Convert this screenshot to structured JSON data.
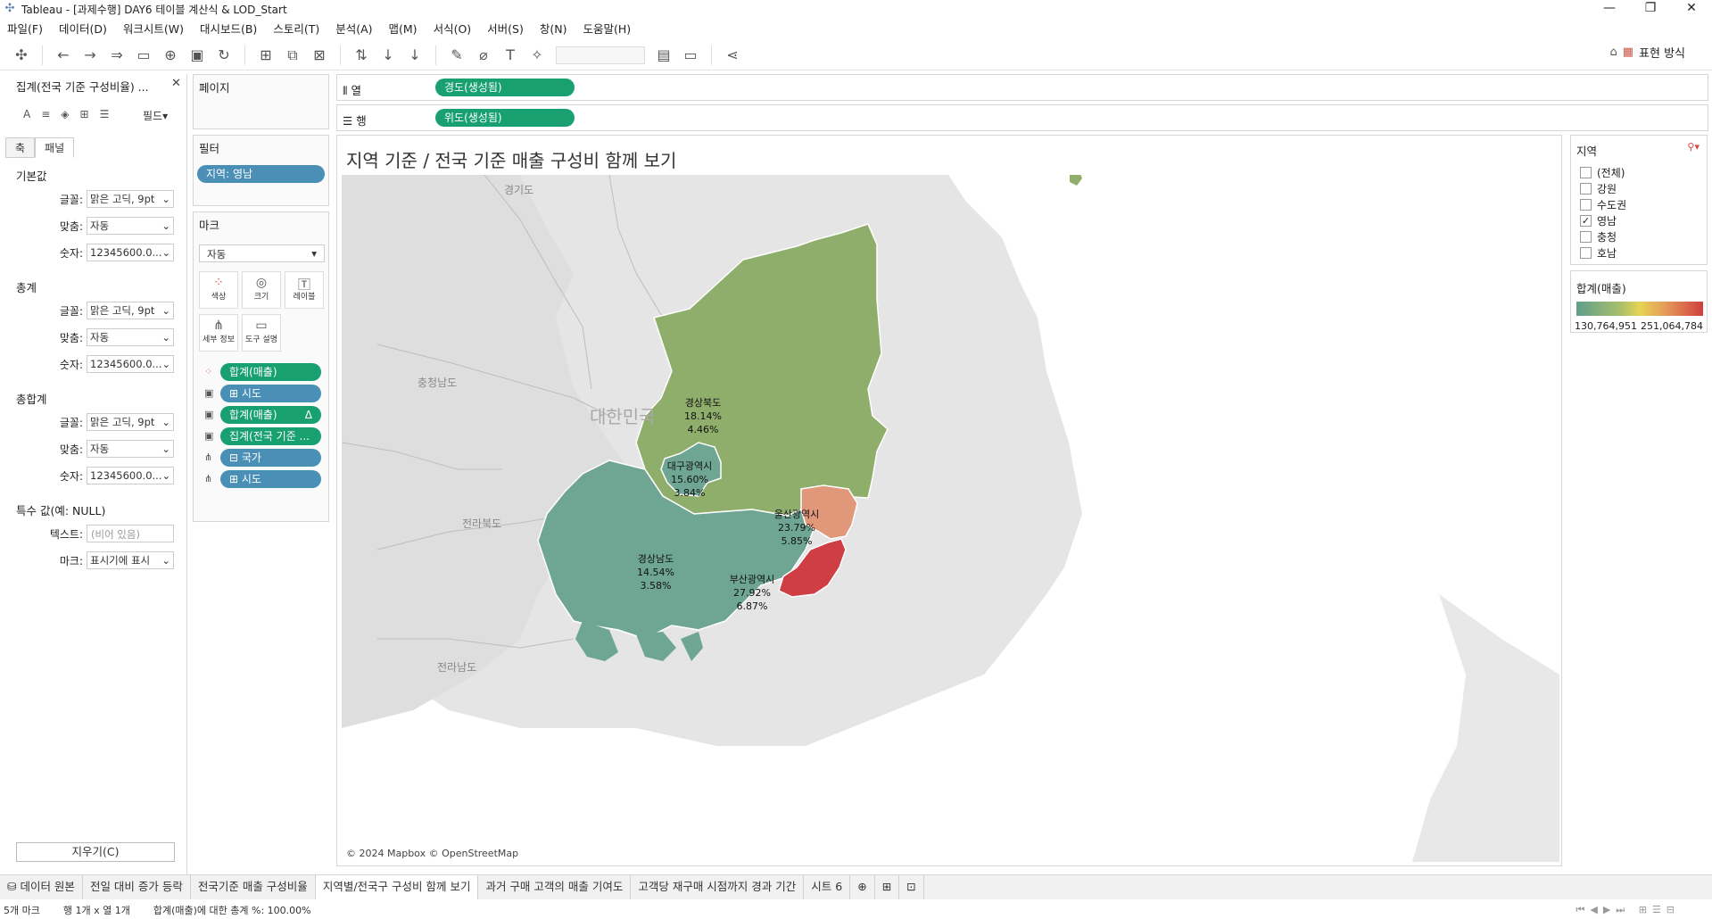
{
  "window": {
    "title": "Tableau - [과제수행] DAY6 테이블 계산식 & LOD_Start",
    "controls": [
      "—",
      "❐",
      "✕"
    ]
  },
  "menu": [
    "파일(F)",
    "데이터(D)",
    "워크시트(W)",
    "대시보드(B)",
    "스토리(T)",
    "분석(A)",
    "맵(M)",
    "서식(O)",
    "서버(S)",
    "창(N)",
    "도움말(H)"
  ],
  "toolbar": {
    "show_me": "표현 방식"
  },
  "format_pane": {
    "title": "집계(전국 기준 구성비율) ...",
    "field_menu": "필드",
    "tabs": [
      "축",
      "패널"
    ],
    "sections": [
      {
        "name": "기본값",
        "rows": [
          {
            "label": "글꼴:",
            "value": "맑은 고딕, 9pt"
          },
          {
            "label": "맞춤:",
            "value": "자동"
          },
          {
            "label": "숫자:",
            "value": "12345600.0..."
          }
        ]
      },
      {
        "name": "총계",
        "rows": [
          {
            "label": "글꼴:",
            "value": "맑은 고딕, 9pt"
          },
          {
            "label": "맞춤:",
            "value": "자동"
          },
          {
            "label": "숫자:",
            "value": "12345600.0..."
          }
        ]
      },
      {
        "name": "총합계",
        "rows": [
          {
            "label": "글꼴:",
            "value": "맑은 고딕, 9pt"
          },
          {
            "label": "맞춤:",
            "value": "자동"
          },
          {
            "label": "숫자:",
            "value": "12345600.0..."
          }
        ]
      }
    ],
    "special": {
      "name": "특수 값(예: NULL)",
      "text_label": "텍스트:",
      "text_placeholder": "(비어 있음)",
      "marks_label": "마크:",
      "marks_value": "표시기에 표시"
    },
    "clear_button": "지우기(C)"
  },
  "cards": {
    "pages": "페이지",
    "filters": {
      "title": "필터",
      "pill": "지역: 영남"
    },
    "marks": {
      "title": "마크",
      "type": "자동",
      "buttons": [
        "색상",
        "크기",
        "레이블",
        "세부 정보",
        "도구 설명"
      ],
      "pills": [
        {
          "icon": "color-dots-icon",
          "label": "합계(매출)",
          "kind": "green"
        },
        {
          "icon": "label-icon",
          "label": "⊞ 시도",
          "kind": "blue"
        },
        {
          "icon": "label-icon",
          "label": "합계(매출)",
          "kind": "green",
          "delta": "Δ"
        },
        {
          "icon": "label-icon",
          "label": "집계(전국 기준 ...",
          "kind": "green"
        },
        {
          "icon": "detail-icon",
          "label": "⊟ 국가",
          "kind": "blue"
        },
        {
          "icon": "detail-icon",
          "label": "⊞ 시도",
          "kind": "blue"
        }
      ]
    }
  },
  "shelves": {
    "columns": {
      "label": "열",
      "pill": "경도(생성됨)"
    },
    "rows": {
      "label": "행",
      "pill": "위도(생성됨)"
    }
  },
  "viz": {
    "title": "지역 기준 / 전국 기준 매출 구성비 함께 보기",
    "attribution": "© 2024 Mapbox © OpenStreetMap",
    "map_text": {
      "country": "대한민국",
      "gyeonggi": "경기도",
      "chungnam": "충청남도",
      "jeonbuk": "전라북도",
      "jeonnam": "전라남도"
    },
    "regions": [
      {
        "name": "경상북도",
        "pct_region": "18.14%",
        "pct_nation": "4.46%",
        "color": "#8fae6c"
      },
      {
        "name": "대구광역시",
        "pct_region": "15.60%",
        "pct_nation": "3.84%",
        "color": "#6ea593"
      },
      {
        "name": "울산광역시",
        "pct_region": "23.79%",
        "pct_nation": "5.85%",
        "color": "#e0977a"
      },
      {
        "name": "경상남도",
        "pct_region": "14.54%",
        "pct_nation": "3.58%",
        "color": "#6ea593"
      },
      {
        "name": "부산광역시",
        "pct_region": "27.92%",
        "pct_nation": "6.87%",
        "color": "#cf3e45"
      }
    ]
  },
  "region_filter": {
    "title": "지역",
    "items": [
      {
        "label": "(전체)",
        "checked": false
      },
      {
        "label": "강원",
        "checked": false
      },
      {
        "label": "수도권",
        "checked": false
      },
      {
        "label": "영남",
        "checked": true
      },
      {
        "label": "충청",
        "checked": false
      },
      {
        "label": "호남",
        "checked": false
      }
    ]
  },
  "color_legend": {
    "title": "합계(매출)",
    "min": "130,764,951",
    "max": "251,064,784"
  },
  "sheet_tabs": [
    "데이터 원본",
    "전일 대비 증가 등락",
    "전국기준 매출 구성비율",
    "지역별/전국구 구성비 함께 보기",
    "과거 구매 고객의 매출 기여도",
    "고객당 재구매 시점까지 경과 기간",
    "시트 6"
  ],
  "active_tab": 3,
  "status": {
    "marks": "5개 마크",
    "rows_cols": "행 1개 x 열 1개",
    "sum": "합계(매출)에 대한 총계 %: 100.00%"
  }
}
